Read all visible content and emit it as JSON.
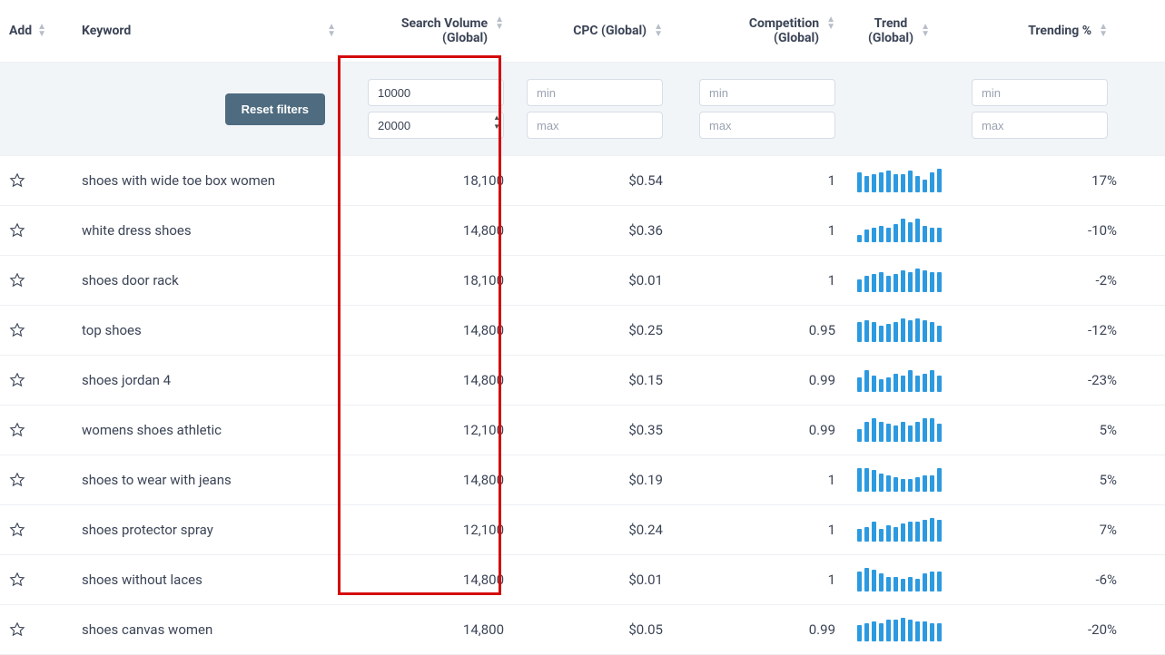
{
  "headers": {
    "add": "Add",
    "keyword": "Keyword",
    "search_volume_line1": "Search Volume",
    "search_volume_line2": "(Global)",
    "cpc": "CPC (Global)",
    "competition_line1": "Competition",
    "competition_line2": "(Global)",
    "trend_line1": "Trend",
    "trend_line2": "(Global)",
    "trending": "Trending %"
  },
  "filters": {
    "reset_label": "Reset filters",
    "sv_min": "10000",
    "sv_max": "20000",
    "min_placeholder": "min",
    "max_placeholder": "max"
  },
  "rows": [
    {
      "keyword": "shoes with wide toe box women",
      "sv": "18,100",
      "cpc": "$0.54",
      "comp": "1",
      "trending": "17%",
      "bars": [
        22,
        18,
        20,
        22,
        24,
        20,
        20,
        24,
        18,
        14,
        22,
        26
      ]
    },
    {
      "keyword": "white dress shoes",
      "sv": "14,800",
      "cpc": "$0.36",
      "comp": "1",
      "trending": "-10%",
      "bars": [
        8,
        14,
        16,
        18,
        16,
        20,
        26,
        22,
        26,
        18,
        16,
        16
      ]
    },
    {
      "keyword": "shoes door rack",
      "sv": "18,100",
      "cpc": "$0.01",
      "comp": "1",
      "trending": "-2%",
      "bars": [
        14,
        18,
        20,
        22,
        18,
        20,
        24,
        22,
        26,
        24,
        22,
        22
      ]
    },
    {
      "keyword": "top shoes",
      "sv": "14,800",
      "cpc": "$0.25",
      "comp": "0.95",
      "trending": "-12%",
      "bars": [
        22,
        24,
        22,
        18,
        20,
        22,
        26,
        24,
        26,
        24,
        22,
        18
      ]
    },
    {
      "keyword": "shoes jordan 4",
      "sv": "14,800",
      "cpc": "$0.15",
      "comp": "0.99",
      "trending": "-23%",
      "bars": [
        16,
        24,
        18,
        14,
        16,
        20,
        18,
        24,
        18,
        20,
        24,
        18
      ]
    },
    {
      "keyword": "womens shoes athletic",
      "sv": "12,100",
      "cpc": "$0.35",
      "comp": "0.99",
      "trending": "5%",
      "bars": [
        14,
        22,
        26,
        22,
        20,
        18,
        22,
        18,
        22,
        26,
        26,
        20
      ]
    },
    {
      "keyword": "shoes to wear with jeans",
      "sv": "14,800",
      "cpc": "$0.19",
      "comp": "1",
      "trending": "5%",
      "bars": [
        26,
        26,
        24,
        20,
        18,
        16,
        14,
        14,
        16,
        18,
        18,
        26
      ]
    },
    {
      "keyword": "shoes protector spray",
      "sv": "12,100",
      "cpc": "$0.24",
      "comp": "1",
      "trending": "7%",
      "bars": [
        14,
        16,
        22,
        14,
        18,
        16,
        20,
        22,
        22,
        24,
        26,
        24
      ]
    },
    {
      "keyword": "shoes without laces",
      "sv": "14,800",
      "cpc": "$0.01",
      "comp": "1",
      "trending": "-6%",
      "bars": [
        22,
        26,
        24,
        20,
        16,
        16,
        14,
        16,
        14,
        20,
        22,
        22
      ]
    },
    {
      "keyword": "shoes canvas women",
      "sv": "14,800",
      "cpc": "$0.05",
      "comp": "0.99",
      "trending": "-20%",
      "bars": [
        18,
        20,
        22,
        20,
        24,
        24,
        26,
        24,
        22,
        22,
        20,
        20
      ]
    }
  ]
}
